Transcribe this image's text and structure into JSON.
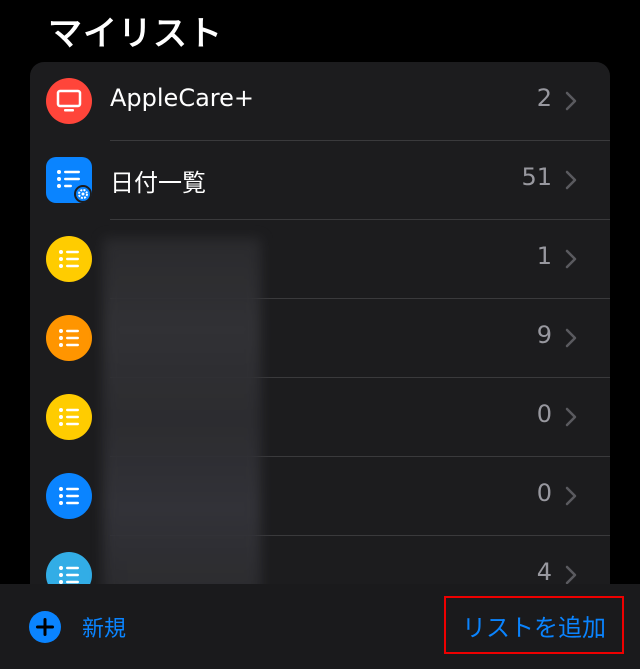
{
  "header": {
    "title": "マイリスト"
  },
  "lists": [
    {
      "label": "AppleCare+",
      "count": "2",
      "icon": "tv-icon",
      "color": "#ff453a"
    },
    {
      "label": "日付一覧",
      "count": "51",
      "icon": "list-settings-icon",
      "color": "#0a84ff"
    },
    {
      "label": "",
      "count": "1",
      "icon": "list-icon",
      "color": "#ffcc00"
    },
    {
      "label": "",
      "count": "9",
      "icon": "list-icon",
      "color": "#ff9500"
    },
    {
      "label": "",
      "count": "0",
      "icon": "list-icon",
      "color": "#ffcc00"
    },
    {
      "label": "",
      "count": "0",
      "icon": "list-icon",
      "color": "#0a84ff"
    },
    {
      "label": "",
      "count": "4",
      "icon": "list-icon",
      "color": "#32ade6"
    }
  ],
  "toolbar": {
    "new_label": "新規",
    "add_list_label": "リストを追加",
    "accent": "#0a84ff"
  }
}
